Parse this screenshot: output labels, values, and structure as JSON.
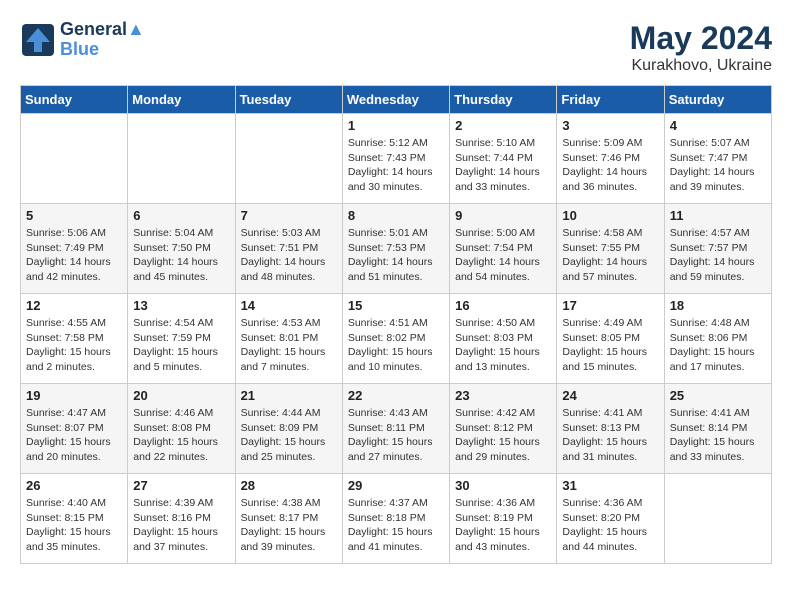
{
  "header": {
    "logo_line1": "General",
    "logo_line2": "Blue",
    "month_year": "May 2024",
    "location": "Kurakhovo, Ukraine"
  },
  "weekdays": [
    "Sunday",
    "Monday",
    "Tuesday",
    "Wednesday",
    "Thursday",
    "Friday",
    "Saturday"
  ],
  "weeks": [
    [
      {
        "day": "",
        "info": ""
      },
      {
        "day": "",
        "info": ""
      },
      {
        "day": "",
        "info": ""
      },
      {
        "day": "1",
        "info": "Sunrise: 5:12 AM\nSunset: 7:43 PM\nDaylight: 14 hours\nand 30 minutes."
      },
      {
        "day": "2",
        "info": "Sunrise: 5:10 AM\nSunset: 7:44 PM\nDaylight: 14 hours\nand 33 minutes."
      },
      {
        "day": "3",
        "info": "Sunrise: 5:09 AM\nSunset: 7:46 PM\nDaylight: 14 hours\nand 36 minutes."
      },
      {
        "day": "4",
        "info": "Sunrise: 5:07 AM\nSunset: 7:47 PM\nDaylight: 14 hours\nand 39 minutes."
      }
    ],
    [
      {
        "day": "5",
        "info": "Sunrise: 5:06 AM\nSunset: 7:49 PM\nDaylight: 14 hours\nand 42 minutes."
      },
      {
        "day": "6",
        "info": "Sunrise: 5:04 AM\nSunset: 7:50 PM\nDaylight: 14 hours\nand 45 minutes."
      },
      {
        "day": "7",
        "info": "Sunrise: 5:03 AM\nSunset: 7:51 PM\nDaylight: 14 hours\nand 48 minutes."
      },
      {
        "day": "8",
        "info": "Sunrise: 5:01 AM\nSunset: 7:53 PM\nDaylight: 14 hours\nand 51 minutes."
      },
      {
        "day": "9",
        "info": "Sunrise: 5:00 AM\nSunset: 7:54 PM\nDaylight: 14 hours\nand 54 minutes."
      },
      {
        "day": "10",
        "info": "Sunrise: 4:58 AM\nSunset: 7:55 PM\nDaylight: 14 hours\nand 57 minutes."
      },
      {
        "day": "11",
        "info": "Sunrise: 4:57 AM\nSunset: 7:57 PM\nDaylight: 14 hours\nand 59 minutes."
      }
    ],
    [
      {
        "day": "12",
        "info": "Sunrise: 4:55 AM\nSunset: 7:58 PM\nDaylight: 15 hours\nand 2 minutes."
      },
      {
        "day": "13",
        "info": "Sunrise: 4:54 AM\nSunset: 7:59 PM\nDaylight: 15 hours\nand 5 minutes."
      },
      {
        "day": "14",
        "info": "Sunrise: 4:53 AM\nSunset: 8:01 PM\nDaylight: 15 hours\nand 7 minutes."
      },
      {
        "day": "15",
        "info": "Sunrise: 4:51 AM\nSunset: 8:02 PM\nDaylight: 15 hours\nand 10 minutes."
      },
      {
        "day": "16",
        "info": "Sunrise: 4:50 AM\nSunset: 8:03 PM\nDaylight: 15 hours\nand 13 minutes."
      },
      {
        "day": "17",
        "info": "Sunrise: 4:49 AM\nSunset: 8:05 PM\nDaylight: 15 hours\nand 15 minutes."
      },
      {
        "day": "18",
        "info": "Sunrise: 4:48 AM\nSunset: 8:06 PM\nDaylight: 15 hours\nand 17 minutes."
      }
    ],
    [
      {
        "day": "19",
        "info": "Sunrise: 4:47 AM\nSunset: 8:07 PM\nDaylight: 15 hours\nand 20 minutes."
      },
      {
        "day": "20",
        "info": "Sunrise: 4:46 AM\nSunset: 8:08 PM\nDaylight: 15 hours\nand 22 minutes."
      },
      {
        "day": "21",
        "info": "Sunrise: 4:44 AM\nSunset: 8:09 PM\nDaylight: 15 hours\nand 25 minutes."
      },
      {
        "day": "22",
        "info": "Sunrise: 4:43 AM\nSunset: 8:11 PM\nDaylight: 15 hours\nand 27 minutes."
      },
      {
        "day": "23",
        "info": "Sunrise: 4:42 AM\nSunset: 8:12 PM\nDaylight: 15 hours\nand 29 minutes."
      },
      {
        "day": "24",
        "info": "Sunrise: 4:41 AM\nSunset: 8:13 PM\nDaylight: 15 hours\nand 31 minutes."
      },
      {
        "day": "25",
        "info": "Sunrise: 4:41 AM\nSunset: 8:14 PM\nDaylight: 15 hours\nand 33 minutes."
      }
    ],
    [
      {
        "day": "26",
        "info": "Sunrise: 4:40 AM\nSunset: 8:15 PM\nDaylight: 15 hours\nand 35 minutes."
      },
      {
        "day": "27",
        "info": "Sunrise: 4:39 AM\nSunset: 8:16 PM\nDaylight: 15 hours\nand 37 minutes."
      },
      {
        "day": "28",
        "info": "Sunrise: 4:38 AM\nSunset: 8:17 PM\nDaylight: 15 hours\nand 39 minutes."
      },
      {
        "day": "29",
        "info": "Sunrise: 4:37 AM\nSunset: 8:18 PM\nDaylight: 15 hours\nand 41 minutes."
      },
      {
        "day": "30",
        "info": "Sunrise: 4:36 AM\nSunset: 8:19 PM\nDaylight: 15 hours\nand 43 minutes."
      },
      {
        "day": "31",
        "info": "Sunrise: 4:36 AM\nSunset: 8:20 PM\nDaylight: 15 hours\nand 44 minutes."
      },
      {
        "day": "",
        "info": ""
      }
    ]
  ]
}
